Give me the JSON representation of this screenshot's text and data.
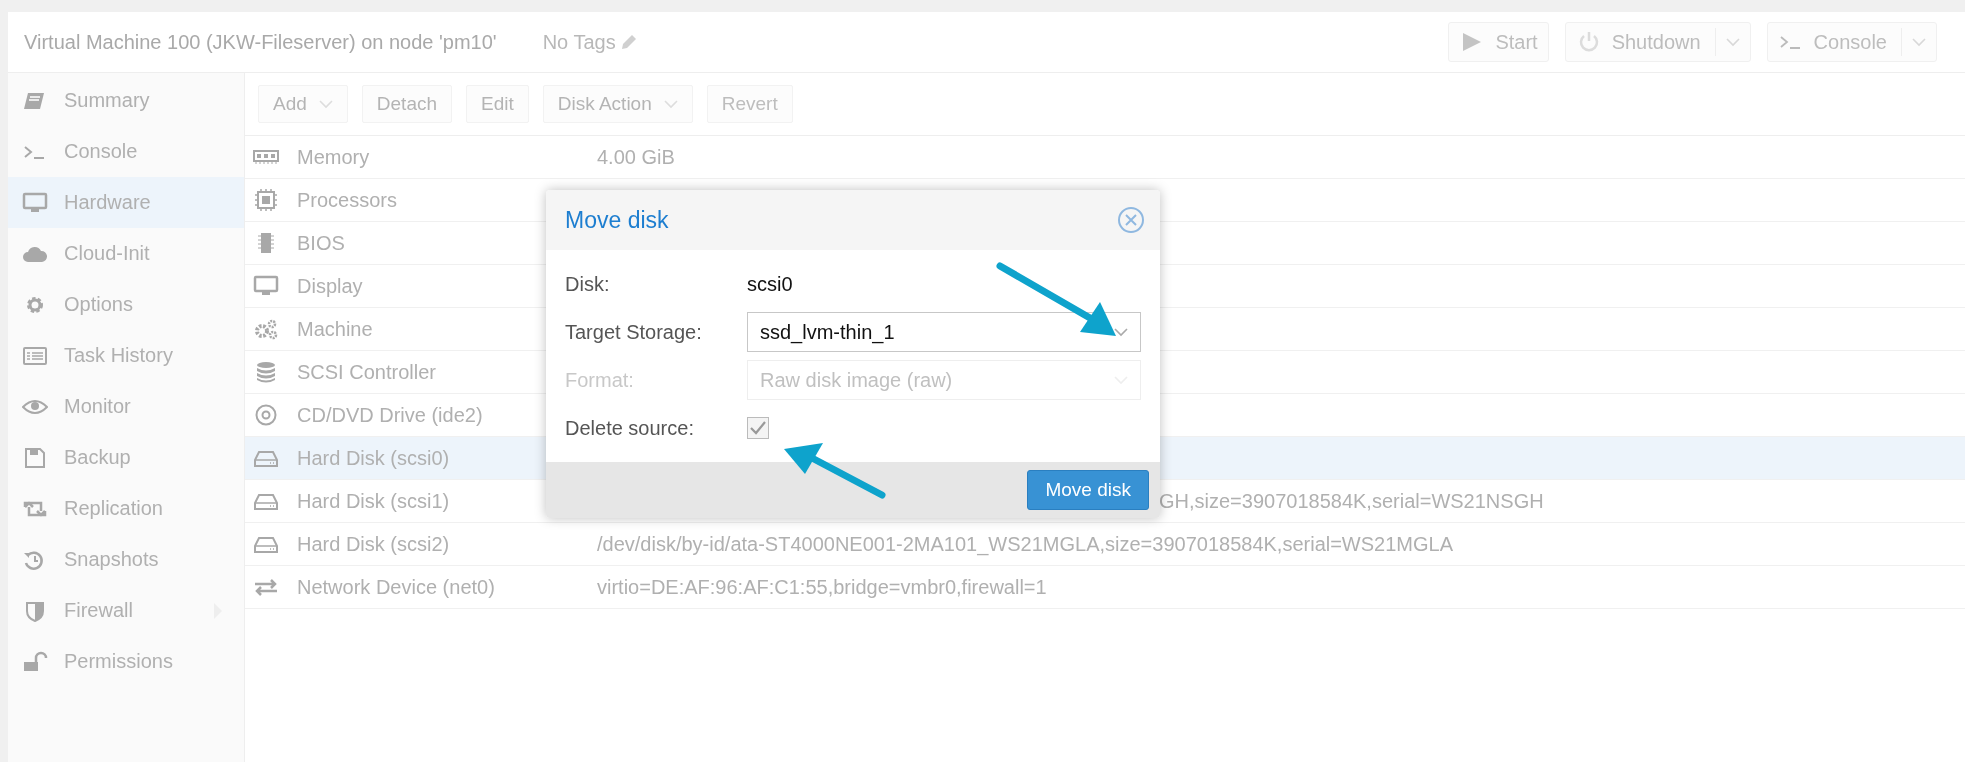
{
  "header": {
    "title": "Virtual Machine 100 (JKW-Fileserver) on node 'pm10'",
    "tags": "No Tags",
    "buttons": [
      {
        "label": "Start",
        "kind": "start",
        "disabled": false,
        "menu": false
      },
      {
        "label": "Shutdown",
        "kind": "shutdown",
        "disabled": true,
        "menu": true
      },
      {
        "label": "Console",
        "kind": "console",
        "disabled": false,
        "menu": true
      }
    ]
  },
  "sidebar": {
    "items": [
      {
        "label": "Summary",
        "kind": "book",
        "selected": false,
        "expandable": false
      },
      {
        "label": "Console",
        "kind": "terminal",
        "selected": false,
        "expandable": false
      },
      {
        "label": "Hardware",
        "kind": "monitor",
        "selected": true,
        "expandable": false
      },
      {
        "label": "Cloud-Init",
        "kind": "cloud",
        "selected": false,
        "expandable": false
      },
      {
        "label": "Options",
        "kind": "gear",
        "selected": false,
        "expandable": false
      },
      {
        "label": "Task History",
        "kind": "list",
        "selected": false,
        "expandable": false
      },
      {
        "label": "Monitor",
        "kind": "eye",
        "selected": false,
        "expandable": false
      },
      {
        "label": "Backup",
        "kind": "floppy",
        "selected": false,
        "expandable": false
      },
      {
        "label": "Replication",
        "kind": "retweet",
        "selected": false,
        "expandable": false
      },
      {
        "label": "Snapshots",
        "kind": "history",
        "selected": false,
        "expandable": false
      },
      {
        "label": "Firewall",
        "kind": "shield",
        "selected": false,
        "expandable": true
      },
      {
        "label": "Permissions",
        "kind": "unlock",
        "selected": false,
        "expandable": false
      }
    ]
  },
  "toolbar": {
    "buttons": [
      {
        "label": "Add",
        "menu": true,
        "disabled": false
      },
      {
        "label": "Detach",
        "menu": false,
        "disabled": false
      },
      {
        "label": "Edit",
        "menu": false,
        "disabled": false
      },
      {
        "label": "Disk Action",
        "menu": true,
        "disabled": false
      },
      {
        "label": "Revert",
        "menu": false,
        "disabled": true
      }
    ]
  },
  "hardware": {
    "rows": [
      {
        "kind": "memory",
        "name": "Memory",
        "value": "4.00 GiB",
        "selected": false
      },
      {
        "kind": "cpu",
        "name": "Processors",
        "selected": false
      },
      {
        "kind": "chip",
        "name": "BIOS",
        "selected": false
      },
      {
        "kind": "monitor",
        "name": "Display",
        "selected": false
      },
      {
        "kind": "gears",
        "name": "Machine",
        "selected": false
      },
      {
        "kind": "database",
        "name": "SCSI Controller",
        "selected": false
      },
      {
        "kind": "disc",
        "name": "CD/DVD Drive (ide2)",
        "selected": false
      },
      {
        "kind": "hdd",
        "name": "Hard Disk (scsi0)",
        "selected": true
      },
      {
        "kind": "hdd",
        "name": "Hard Disk (scsi1)",
        "value": "GH,size=3907018584K,serial=WS21NSGH",
        "selected": false
      },
      {
        "kind": "hdd",
        "name": "Hard Disk (scsi2)",
        "value": "/dev/disk/by-id/ata-ST4000NE001-2MA101_WS21MGLA,size=3907018584K,serial=WS21MGLA",
        "selected": false
      },
      {
        "kind": "exchange",
        "name": "Network Device (net0)",
        "value": "virtio=DE:AF:96:AF:C1:55,bridge=vmbr0,firewall=1",
        "selected": false
      }
    ]
  },
  "dialog": {
    "title": "Move disk",
    "fields": [
      {
        "kind": "display",
        "label": "Disk:",
        "value": "scsi0",
        "disabled": false
      },
      {
        "kind": "select",
        "label": "Target Storage:",
        "value": "ssd_lvm-thin_1",
        "disabled": false
      },
      {
        "kind": "select",
        "label": "Format:",
        "value": "Raw disk image (raw)",
        "disabled": true
      },
      {
        "kind": "checkbox",
        "label": "Delete source:",
        "checked": true,
        "disabled": false
      }
    ],
    "button": "Move disk"
  }
}
